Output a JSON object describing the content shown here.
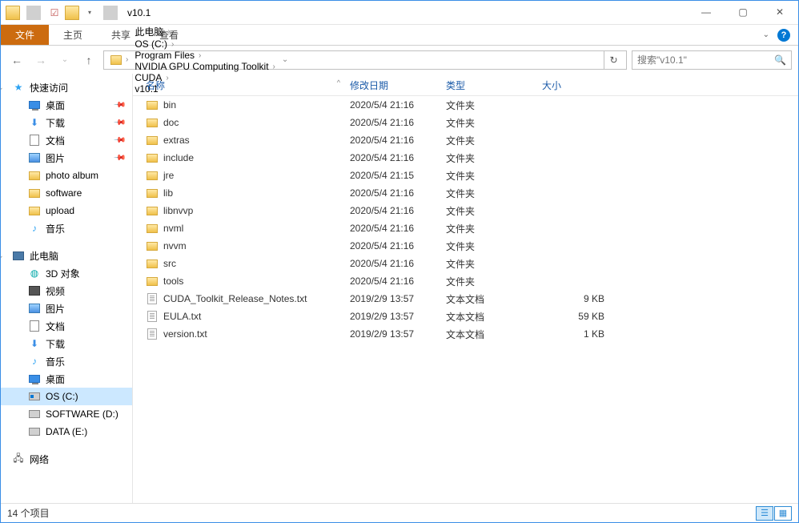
{
  "window": {
    "title": "v10.1"
  },
  "ribbon": {
    "file": "文件",
    "home": "主页",
    "share": "共享",
    "view": "查看"
  },
  "breadcrumbs": [
    "此电脑",
    "OS (C:)",
    "Program Files",
    "NVIDIA GPU Computing Toolkit",
    "CUDA",
    "v10.1"
  ],
  "search": {
    "placeholder": "搜索\"v10.1\""
  },
  "nav": {
    "quick_access": "快速访问",
    "quick_items": [
      {
        "label": "桌面",
        "icon": "desktop",
        "pin": true
      },
      {
        "label": "下载",
        "icon": "download",
        "pin": true
      },
      {
        "label": "文档",
        "icon": "doc",
        "pin": true
      },
      {
        "label": "图片",
        "icon": "pic",
        "pin": true
      },
      {
        "label": "photo album",
        "icon": "folder",
        "pin": false
      },
      {
        "label": "software",
        "icon": "folder",
        "pin": false
      },
      {
        "label": "upload",
        "icon": "folder",
        "pin": false
      },
      {
        "label": "音乐",
        "icon": "music",
        "pin": false
      }
    ],
    "this_pc": "此电脑",
    "pc_items": [
      {
        "label": "3D 对象",
        "icon": "3d"
      },
      {
        "label": "视频",
        "icon": "video"
      },
      {
        "label": "图片",
        "icon": "pic"
      },
      {
        "label": "文档",
        "icon": "doc"
      },
      {
        "label": "下载",
        "icon": "download"
      },
      {
        "label": "音乐",
        "icon": "music"
      },
      {
        "label": "桌面",
        "icon": "desktop"
      },
      {
        "label": "OS (C:)",
        "icon": "drive-os",
        "selected": true
      },
      {
        "label": "SOFTWARE (D:)",
        "icon": "drive"
      },
      {
        "label": "DATA (E:)",
        "icon": "drive"
      }
    ],
    "network": "网络"
  },
  "columns": {
    "name": "名称",
    "modified": "修改日期",
    "type": "类型",
    "size": "大小"
  },
  "files": [
    {
      "name": "bin",
      "modified": "2020/5/4 21:16",
      "type": "文件夹",
      "size": "",
      "kind": "folder"
    },
    {
      "name": "doc",
      "modified": "2020/5/4 21:16",
      "type": "文件夹",
      "size": "",
      "kind": "folder"
    },
    {
      "name": "extras",
      "modified": "2020/5/4 21:16",
      "type": "文件夹",
      "size": "",
      "kind": "folder"
    },
    {
      "name": "include",
      "modified": "2020/5/4 21:16",
      "type": "文件夹",
      "size": "",
      "kind": "folder"
    },
    {
      "name": "jre",
      "modified": "2020/5/4 21:15",
      "type": "文件夹",
      "size": "",
      "kind": "folder"
    },
    {
      "name": "lib",
      "modified": "2020/5/4 21:16",
      "type": "文件夹",
      "size": "",
      "kind": "folder"
    },
    {
      "name": "libnvvp",
      "modified": "2020/5/4 21:16",
      "type": "文件夹",
      "size": "",
      "kind": "folder"
    },
    {
      "name": "nvml",
      "modified": "2020/5/4 21:16",
      "type": "文件夹",
      "size": "",
      "kind": "folder"
    },
    {
      "name": "nvvm",
      "modified": "2020/5/4 21:16",
      "type": "文件夹",
      "size": "",
      "kind": "folder"
    },
    {
      "name": "src",
      "modified": "2020/5/4 21:16",
      "type": "文件夹",
      "size": "",
      "kind": "folder"
    },
    {
      "name": "tools",
      "modified": "2020/5/4 21:16",
      "type": "文件夹",
      "size": "",
      "kind": "folder"
    },
    {
      "name": "CUDA_Toolkit_Release_Notes.txt",
      "modified": "2019/2/9 13:57",
      "type": "文本文档",
      "size": "9 KB",
      "kind": "txt"
    },
    {
      "name": "EULA.txt",
      "modified": "2019/2/9 13:57",
      "type": "文本文档",
      "size": "59 KB",
      "kind": "txt"
    },
    {
      "name": "version.txt",
      "modified": "2019/2/9 13:57",
      "type": "文本文档",
      "size": "1 KB",
      "kind": "txt"
    }
  ],
  "status": {
    "count": "14 个项目"
  }
}
